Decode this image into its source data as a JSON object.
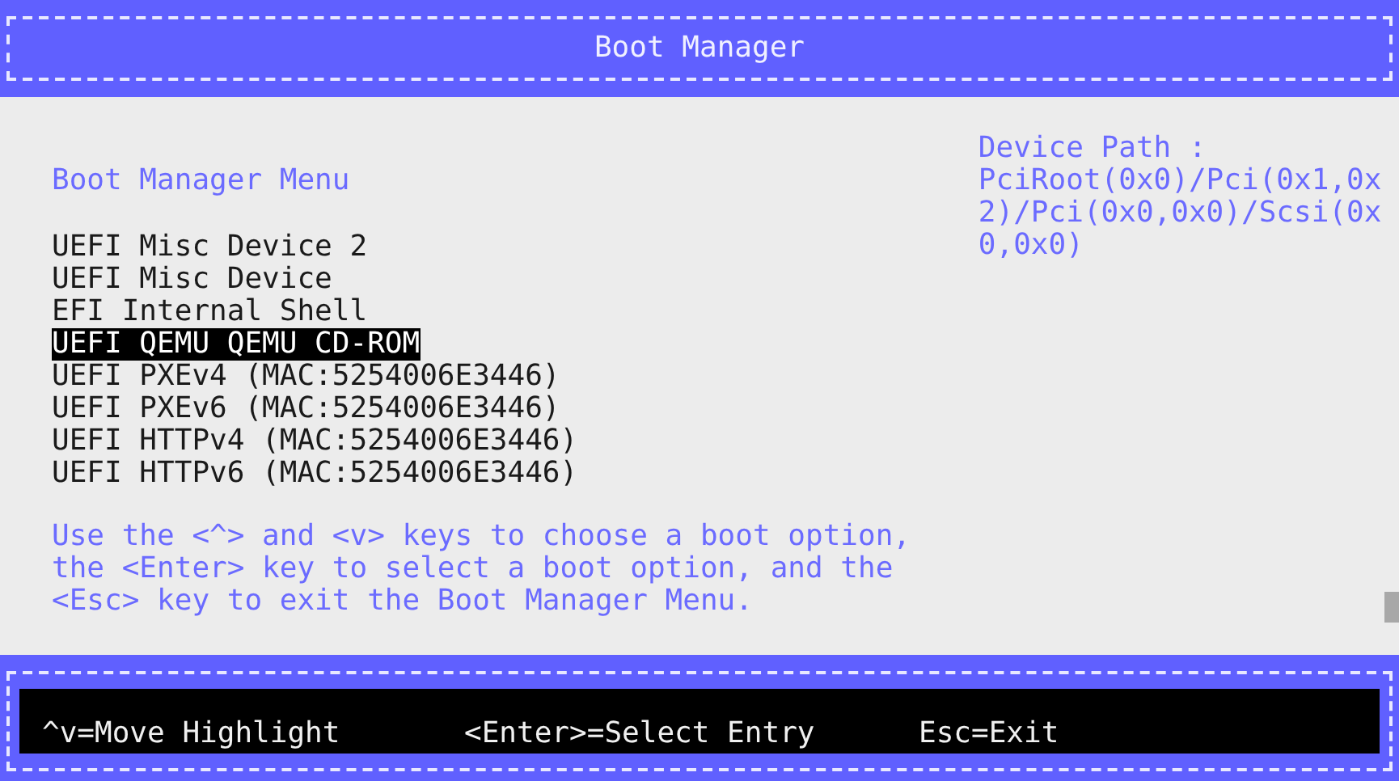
{
  "window": {
    "title": "Boot Manager"
  },
  "menu": {
    "heading": "Boot Manager Menu",
    "items": [
      {
        "label": "UEFI Misc Device 2",
        "selected": false
      },
      {
        "label": "UEFI Misc Device",
        "selected": false
      },
      {
        "label": "EFI Internal Shell",
        "selected": false
      },
      {
        "label": "UEFI QEMU QEMU CD-ROM",
        "selected": true
      },
      {
        "label": "UEFI PXEv4 (MAC:5254006E3446)",
        "selected": false
      },
      {
        "label": "UEFI PXEv6 (MAC:5254006E3446)",
        "selected": false
      },
      {
        "label": "UEFI HTTPv4 (MAC:5254006E3446)",
        "selected": false
      },
      {
        "label": "UEFI HTTPv6 (MAC:5254006E3446)",
        "selected": false
      }
    ],
    "help": [
      "Use the <^> and <v> keys to choose a boot option,",
      "the <Enter> key to select a boot option, and the",
      "<Esc> key to exit the Boot Manager Menu."
    ]
  },
  "device_path": {
    "label": "Device Path :",
    "value": "PciRoot(0x0)/Pci(0x1,0x2)/Pci(0x0,0x0)/Scsi(0x0,0x0)"
  },
  "status_bar": [
    "^v=Move Highlight",
    "<Enter>=Select Entry",
    "Esc=Exit"
  ]
}
